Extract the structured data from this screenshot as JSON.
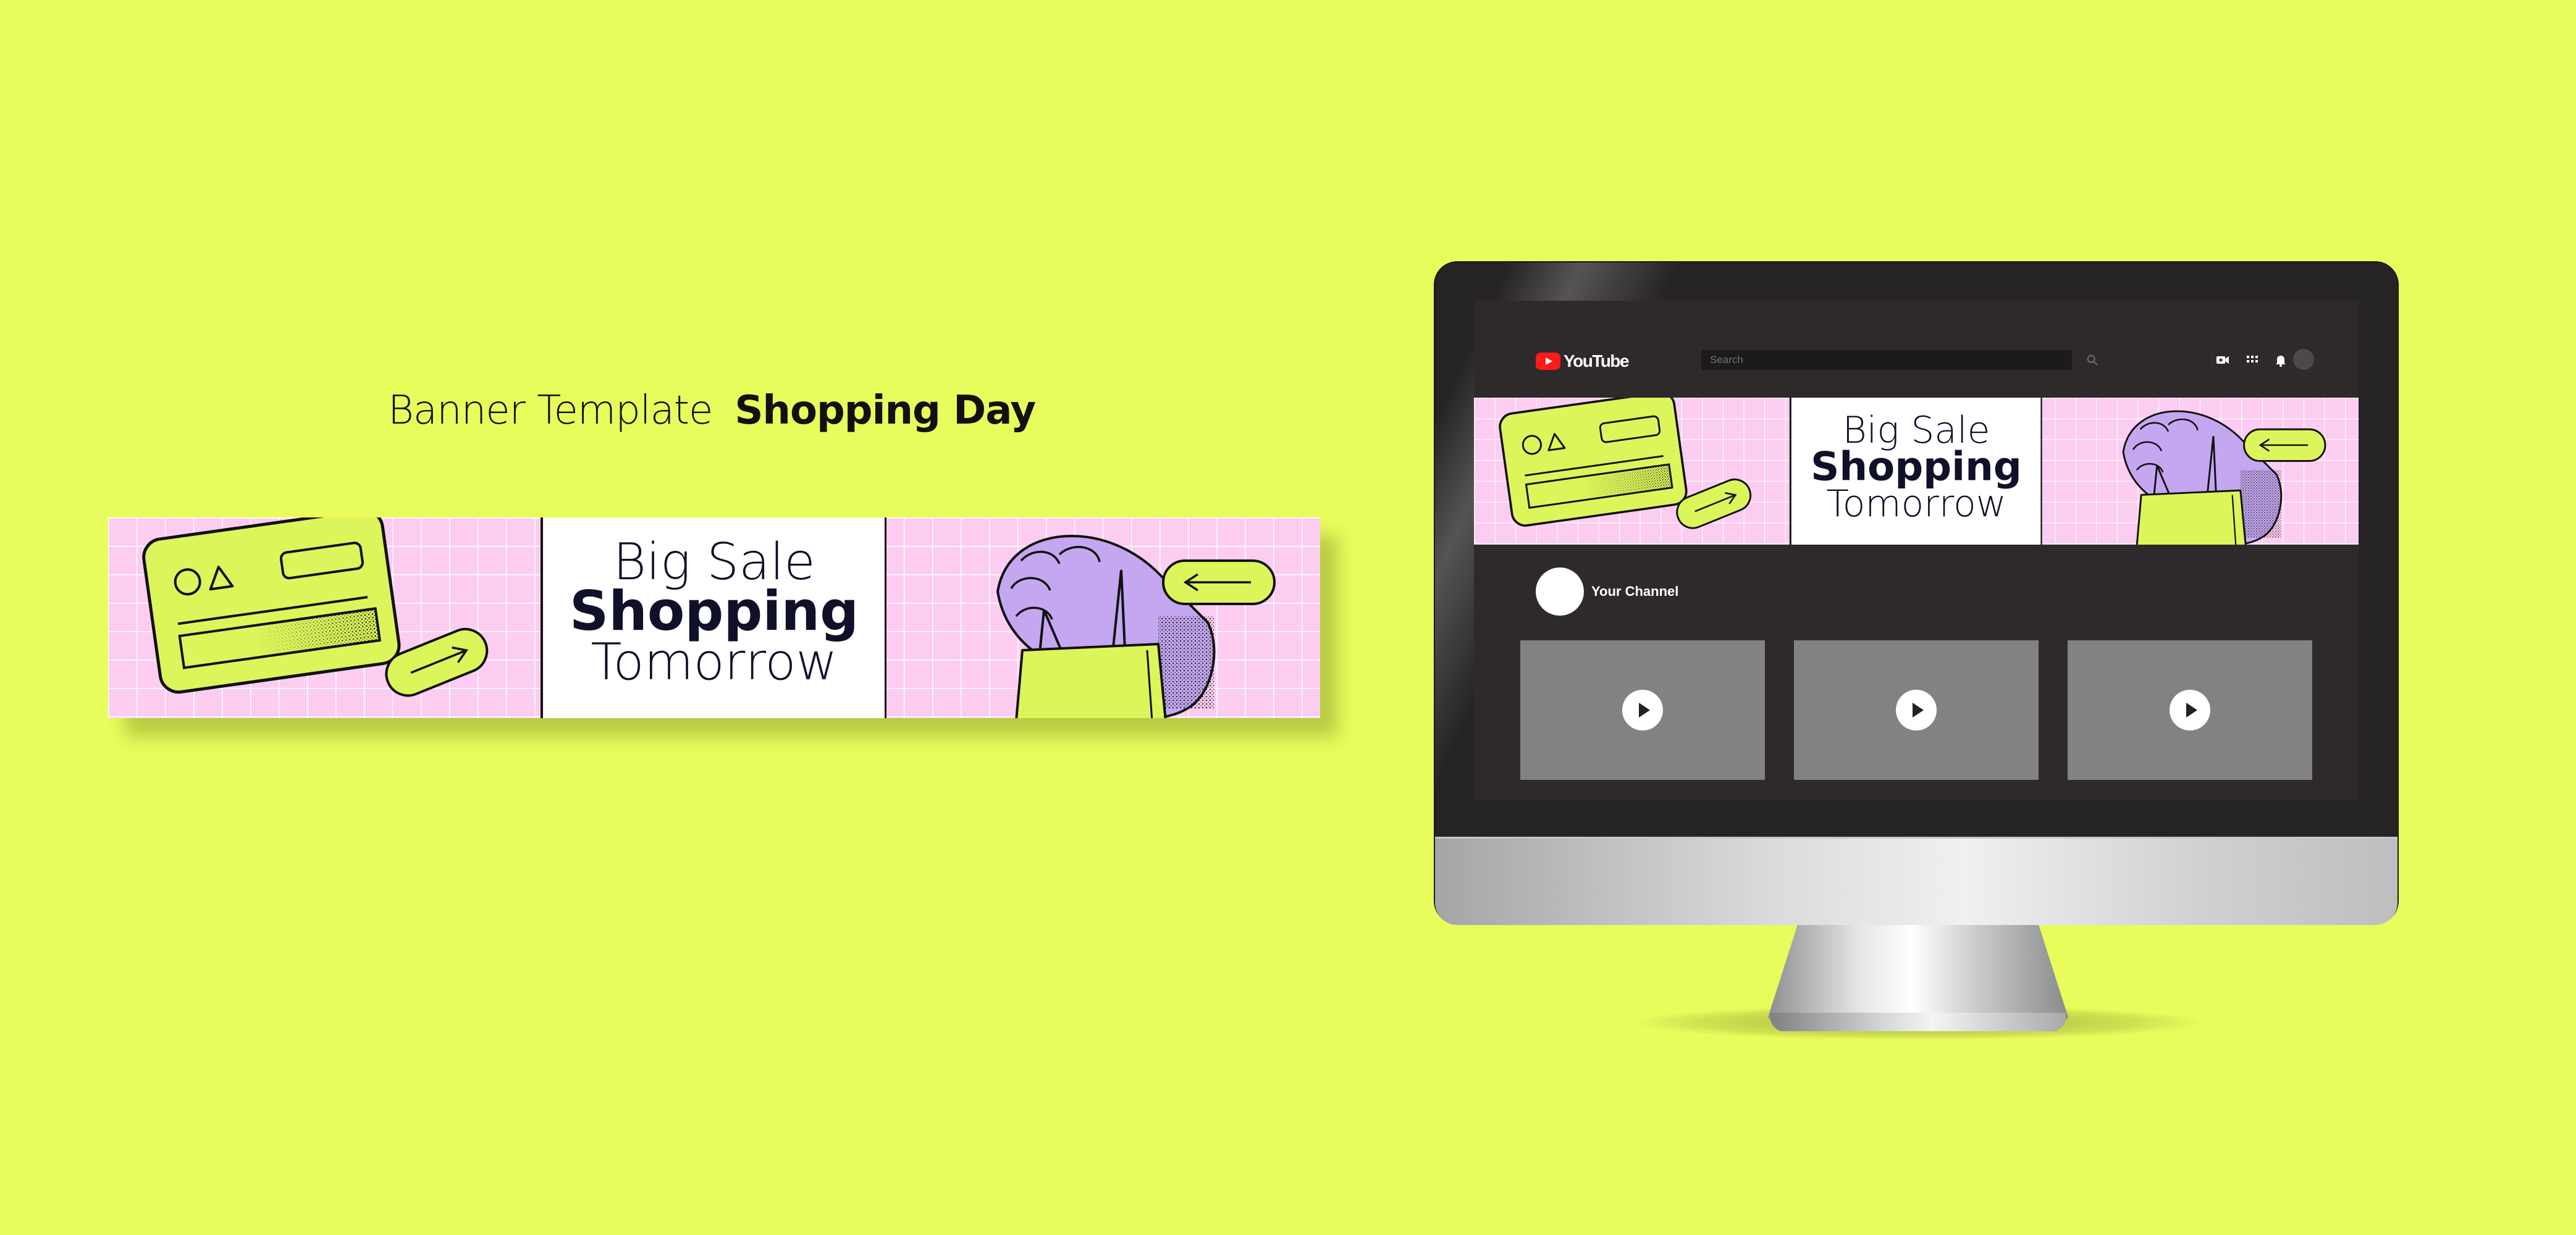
{
  "heading": {
    "light": "Banner Template",
    "bold": "Shopping Day"
  },
  "banner": {
    "line1": "Big Sale",
    "line2": "Shopping",
    "line3": "Tomorrow"
  },
  "youtube": {
    "logo_text": "YouTube",
    "search_placeholder": "Search",
    "channel_name": "Your Channel",
    "videos": [
      "video-1",
      "video-2",
      "video-3"
    ]
  },
  "colors": {
    "background": "#e8fc5c",
    "banner_pink": "#fccdf0",
    "accent_lime": "#dcf55a",
    "lavender": "#c4a7f0",
    "ink": "#10102a",
    "screen_dark": "#2e2a2b",
    "youtube_red": "#ff1a1a"
  },
  "icons": [
    "credit-card-icon",
    "arrow-pill-icon",
    "hand-holding-bag-icon",
    "search-icon",
    "create-video-icon",
    "apps-icon",
    "bell-icon",
    "play-icon"
  ]
}
